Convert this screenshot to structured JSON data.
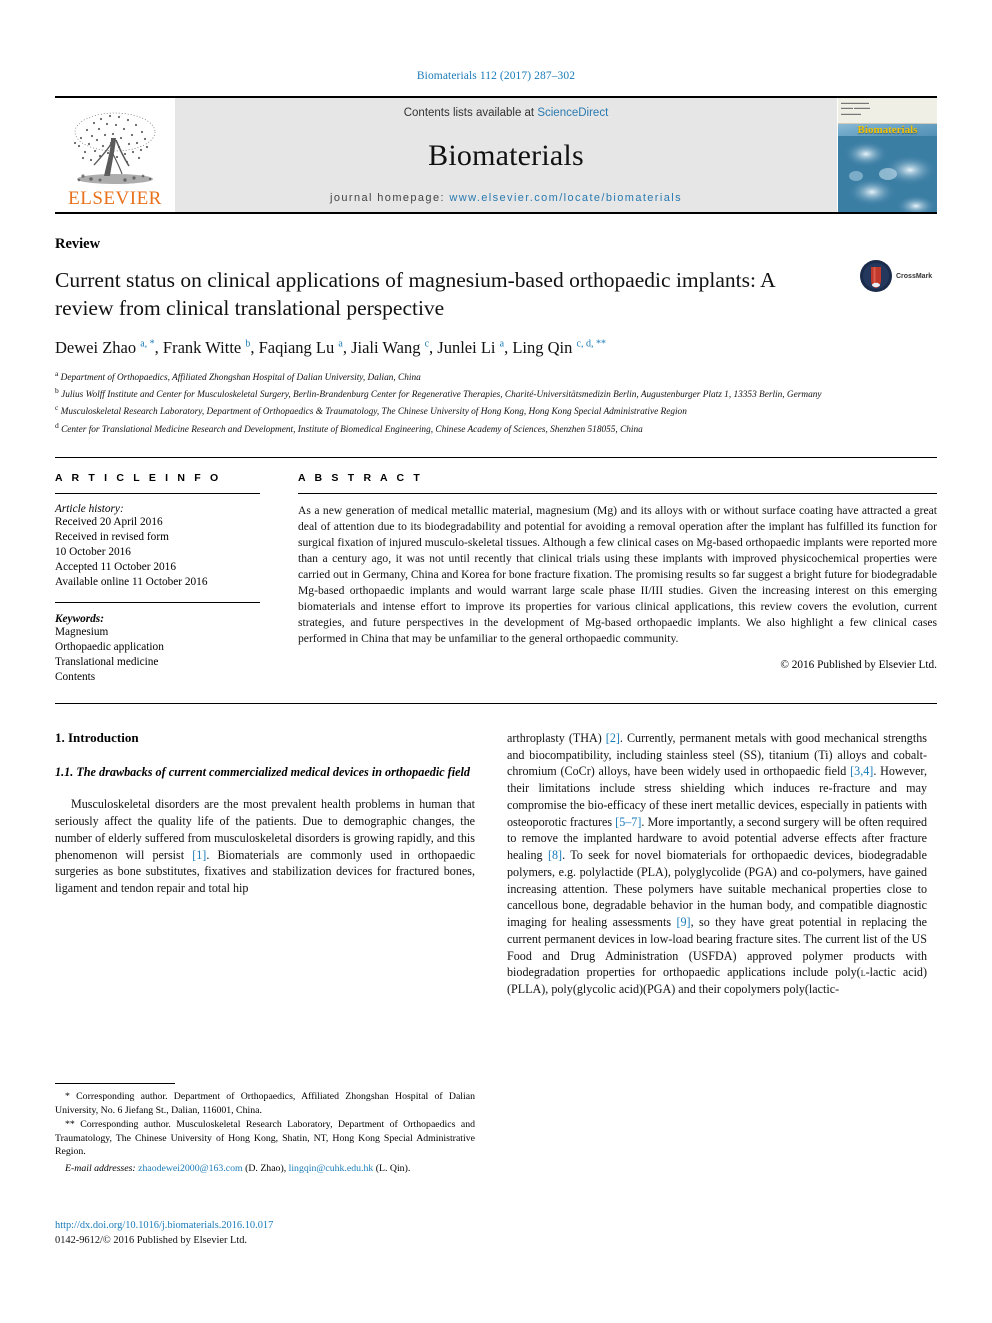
{
  "running_head": "Biomaterials 112 (2017) 287–302",
  "masthead": {
    "publisher_wordmark": "ELSEVIER",
    "contents_prefix": "Contents lists available at",
    "contents_link": "ScienceDirect",
    "journal_name": "Biomaterials",
    "homepage_prefix": "journal homepage:",
    "homepage_url": "www.elsevier.com/locate/biomaterials",
    "cover_title": "Biomaterials",
    "accent_color": "#2a7ab0",
    "elsevier_orange": "#E9711C"
  },
  "article": {
    "doctype": "Review",
    "title": "Current status on clinical applications of magnesium-based orthopaedic implants: A review from clinical translational perspective",
    "crossmark_label": "CrossMark",
    "authors_html": "Dewei Zhao <sup>a, *</sup>, Frank Witte <sup>b</sup>, Faqiang Lu <sup>a</sup>, Jiali Wang <sup>c</sup>, Junlei Li <sup>a</sup>, Ling Qin <sup>c, d, **</sup>",
    "affiliations": [
      "<sup>a</sup> Department of Orthopaedics, Affiliated Zhongshan Hospital of Dalian University, Dalian, China",
      "<sup>b</sup> Julius Wolff Institute and Center for Musculoskeletal Surgery, Berlin-Brandenburg Center for Regenerative Therapies, Charité-Universitätsmedizin Berlin, Augustenburger Platz 1, 13353 Berlin, Germany",
      "<sup>c</sup> Musculoskeletal Research Laboratory, Department of Orthopaedics &amp; Traumatology, The Chinese University of Hong Kong, Hong Kong Special Administrative Region",
      "<sup>d</sup> Center for Translational Medicine Research and Development, Institute of Biomedical Engineering, Chinese Academy of Sciences, Shenzhen 518055, China"
    ]
  },
  "article_info": {
    "heading": "A R T I C L E   I N F O",
    "history_label": "Article history:",
    "history_lines": [
      "Received 20 April 2016",
      "Received in revised form",
      "10 October 2016",
      "Accepted 11 October 2016",
      "Available online 11 October 2016"
    ],
    "keywords_label": "Keywords:",
    "keywords": [
      "Magnesium",
      "Orthopaedic application",
      "Translational medicine",
      "Contents"
    ]
  },
  "abstract": {
    "heading": "A B S T R A C T",
    "text": "As a new generation of medical metallic material, magnesium (Mg) and its alloys with or without surface coating have attracted a great deal of attention due to its biodegradability and potential for avoiding a removal operation after the implant has fulfilled its function for surgical fixation of injured musculo-skeletal tissues. Although a few clinical cases on Mg-based orthopaedic implants were reported more than a century ago, it was not until recently that clinical trials using these implants with improved physicochemical properties were carried out in Germany, China and Korea for bone fracture fixation. The promising results so far suggest a bright future for biodegradable Mg-based orthopaedic implants and would warrant large scale phase II/III studies. Given the increasing interest on this emerging biomaterials and intense effort to improve its properties for various clinical applications, this review covers the evolution, current strategies, and future perspectives in the development of Mg-based orthopaedic implants. We also highlight a few clinical cases performed in China that may be unfamiliar to the general orthopaedic community.",
    "copyright": "© 2016 Published by Elsevier Ltd."
  },
  "body": {
    "section_1_heading": "1. Introduction",
    "section_1_1_heading": "1.1. The drawbacks of current commercialized medical devices in orthopaedic field",
    "left_paragraph_html": "Musculoskeletal disorders are the most prevalent health problems in human that seriously affect the quality life of the patients. Due to demographic changes, the number of elderly suffered from musculoskeletal disorders is growing rapidly, and this phenomenon will persist <span class=\"ref\">[1]</span>. Biomaterials are commonly used in orthopaedic surgeries as bone substitutes, fixatives and stabilization devices for fractured bones, ligament and tendon repair and total hip",
    "right_paragraph_html": "arthroplasty (THA) <span class=\"ref\">[2]</span>. Currently, permanent metals with good mechanical strengths and biocompatibility, including stainless steel (SS), titanium (Ti) alloys and cobalt-chromium (CoCr) alloys, have been widely used in orthopaedic field <span class=\"ref\">[3,4]</span>. However, their limitations include stress shielding which induces re-fracture and may compromise the bio-efficacy of these inert metallic devices, especially in patients with osteoporotic fractures <span class=\"ref\">[5–7]</span>. More importantly, a second surgery will be often required to remove the implanted hardware to avoid potential adverse effects after fracture healing <span class=\"ref\">[8]</span>. To seek for novel biomaterials for orthopaedic devices, biodegradable polymers, e.g. polylactide (PLA), polyglycolide (PGA) and co-polymers, have gained increasing attention. These polymers have suitable mechanical properties close to cancellous bone, degradable behavior in the human body, and compatible diagnostic imaging for healing assessments <span class=\"ref\">[9]</span>, so they have great potential in replacing the current permanent devices in low-load bearing fracture sites. The current list of the US Food and Drug Administration (USFDA) approved polymer products with biodegradation properties for orthopaedic applications include poly(<span style=\"font-variant:small-caps\">l</span>-lactic acid) (PLLA), poly(glycolic acid)(PGA) and their copolymers poly(lactic-"
  },
  "footnotes": {
    "note_1": "* Corresponding author. Department of Orthopaedics, Affiliated Zhongshan Hospital of Dalian University, No. 6 Jiefang St., Dalian, 116001, China.",
    "note_2": "** Corresponding author. Musculoskeletal Research Laboratory, Department of Orthopaedics and Traumatology, The Chinese University of Hong Kong, Shatin, NT, Hong Kong Special Administrative Region.",
    "email_label": "E-mail addresses:",
    "email_1": "zhaodewei2000@163.com",
    "email_1_owner": "(D. Zhao),",
    "email_2": "lingqin@cuhk.edu.hk",
    "email_2_owner": "(L. Qin)."
  },
  "footer": {
    "doi": "http://dx.doi.org/10.1016/j.biomaterials.2016.10.017",
    "issn_line": "0142-9612/© 2016 Published by Elsevier Ltd."
  }
}
